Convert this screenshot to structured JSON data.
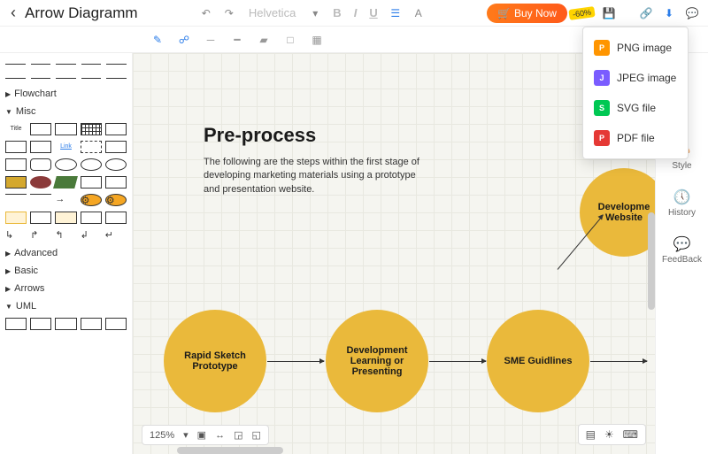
{
  "header": {
    "title": "Arrow Diagramm",
    "font": "Helvetica",
    "buy_label": "Buy Now",
    "discount": "-60%"
  },
  "categories": {
    "flowchart": "Flowchart",
    "misc": "Misc",
    "title_lbl": "Title",
    "link_lbl": "Link",
    "advanced": "Advanced",
    "basic": "Basic",
    "arrows": "Arrows",
    "uml": "UML"
  },
  "canvas": {
    "title": "Pre-process",
    "desc": "The following are the steps within the first stage of developing marketing materials using a prototype and presentation website.",
    "nodes": {
      "n1": "Rapid Sketch Prototype",
      "n2": "Development Learning or Presenting",
      "n3": "SME Guidlines",
      "n4": "Developme Website"
    }
  },
  "zoom": "125%",
  "right": {
    "style": "Style",
    "history": "History",
    "feedback": "FeedBack"
  },
  "export": {
    "png": "PNG image",
    "jpeg": "JPEG image",
    "svg": "SVG file",
    "pdf": "PDF file"
  }
}
